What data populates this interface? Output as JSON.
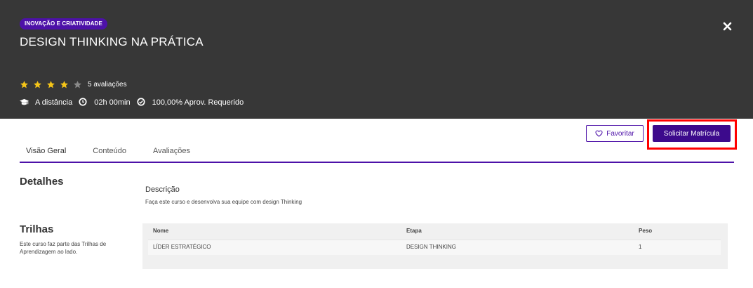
{
  "course": {
    "category_badge": "INOVAÇÃO E CRIATIVIDADE",
    "title": "DESIGN THINKING NA PRÁTICA",
    "rating": 4,
    "rating_max": 5,
    "rating_count": "5 avaliações",
    "modality": "A distância",
    "duration": "02h 00min",
    "approval": "100,00% Aprov. Requerido"
  },
  "actions": {
    "favorite_label": "Favoritar",
    "enroll_label": "Solicitar Matrícula"
  },
  "tabs": [
    {
      "label": "Visão Geral",
      "active": true
    },
    {
      "label": "Conteúdo",
      "active": false
    },
    {
      "label": "Avaliações",
      "active": false
    }
  ],
  "details": {
    "title": "Detalhes",
    "description_label": "Descrição",
    "description": "Faça este curso e desenvolva sua equipe com design Thinking"
  },
  "trilhas": {
    "title": "Trilhas",
    "note": "Este curso faz parte das Trilhas de Aprendizagem ao lado.",
    "columns": [
      "Nome",
      "Etapa",
      "Peso"
    ],
    "rows": [
      [
        "LÍDER ESTRATÉGICO",
        "DESIGN THINKING",
        "1"
      ]
    ]
  },
  "colors": {
    "header_bg": "#373737",
    "accent": "#4d11a8",
    "star_filled": "#f5c518",
    "star_empty": "#8a8a8a",
    "highlight": "#ff0000"
  },
  "icons": {
    "close": "close-icon",
    "star": "star-icon",
    "modality": "graduation-cap-icon",
    "duration": "clock-icon",
    "approval": "check-circle-icon",
    "favorite": "heart-icon"
  }
}
